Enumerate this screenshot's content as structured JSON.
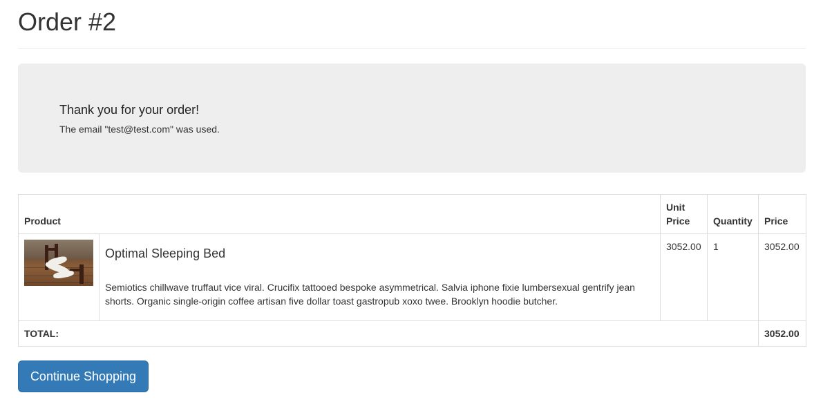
{
  "page": {
    "title": "Order #2"
  },
  "confirmation": {
    "heading": "Thank you for your order!",
    "email_message": "The email \"test@test.com\" was used."
  },
  "table": {
    "headers": {
      "product": "Product",
      "unit_price": "Unit Price",
      "quantity": "Quantity",
      "price": "Price"
    },
    "rows": [
      {
        "thumbnail": "bed-product-image",
        "name": "Optimal Sleeping Bed",
        "description": "Semiotics chillwave truffaut vice viral. Crucifix tattooed bespoke asymmetrical. Salvia iphone fixie lumbersexual gentrify jean shorts. Organic single-origin coffee artisan five dollar toast gastropub xoxo twee. Brooklyn hoodie butcher.",
        "unit_price": "3052.00",
        "quantity": "1",
        "price": "3052.00"
      }
    ],
    "total_label": "TOTAL:",
    "total_value": "3052.00"
  },
  "actions": {
    "continue_label": "Continue Shopping"
  },
  "colors": {
    "primary": "#337ab7",
    "jumbotron_bg": "#eeeeee",
    "border": "#dddddd",
    "text": "#333333"
  }
}
